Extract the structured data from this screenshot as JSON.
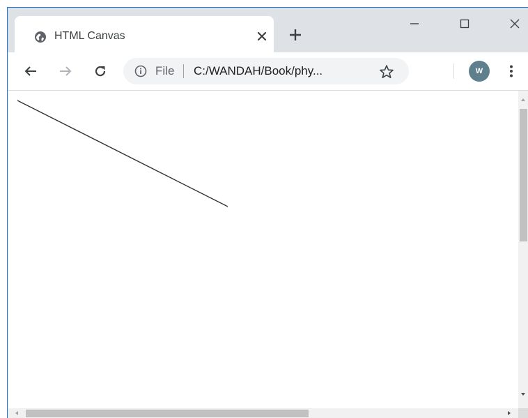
{
  "tab": {
    "title": "HTML Canvas",
    "favicon_icon": "globe-icon",
    "close_icon": "close-icon"
  },
  "tabstrip": {
    "new_tab_icon": "plus-icon",
    "minimize_icon": "minimize-icon",
    "maximize_icon": "maximize-icon",
    "close_window_icon": "close-icon"
  },
  "toolbar": {
    "back_icon": "arrow-left-icon",
    "forward_icon": "arrow-right-icon",
    "reload_icon": "reload-icon",
    "menu_icon": "kebab-menu-icon"
  },
  "omnibox": {
    "info_icon": "info-icon",
    "scheme_label": "File",
    "url": "C:/WANDAH/Book/phy...",
    "bookmark_icon": "star-icon"
  },
  "profile": {
    "initial": "W",
    "color": "#5f7f8c"
  },
  "colors": {
    "tabstrip_bg": "#dee1e6",
    "omnibox_bg": "#f1f3f4",
    "window_border": "#1a73e8",
    "line_stroke": "#333333"
  }
}
